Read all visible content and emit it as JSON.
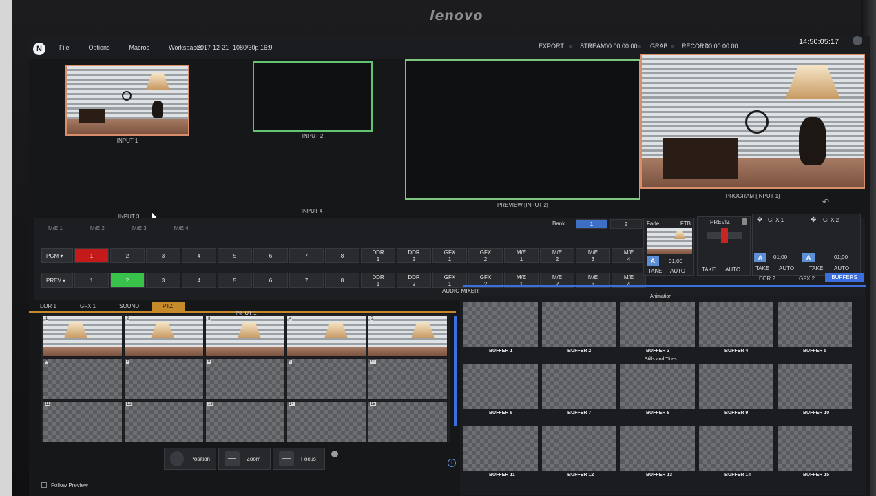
{
  "monitor": {
    "brand": "lenovo"
  },
  "topbar": {
    "menu": [
      "File",
      "Options",
      "Macros",
      "Workspaces"
    ],
    "date": "2017-12-21",
    "format": "1080/30p 16:9",
    "export": "EXPORT",
    "stream": "STREAM",
    "stream_time": "00:00:00:00",
    "grab": "GRAB",
    "record": "RECORD",
    "record_time": "00:00:00:00",
    "clock": "14:50:05:17"
  },
  "monitors": {
    "input1": "INPUT 1",
    "input2": "INPUT 2",
    "input3": "INPUT 3",
    "input4": "INPUT 4",
    "preview": "PREVIEW [INPUT 2]",
    "program": "PROGRAM [INPUT 1]"
  },
  "me_tabs": [
    "M/E 1",
    "M/E 2",
    "M/E 3",
    "M/E 4"
  ],
  "bank": {
    "label": "Bank",
    "options": [
      "1",
      "2"
    ]
  },
  "pgm_row": {
    "label": "PGM ▾",
    "buttons": [
      "1",
      "2",
      "3",
      "4",
      "5",
      "6",
      "7",
      "8",
      "DDR\n1",
      "DDR\n2",
      "GFX\n1",
      "GFX\n2",
      "M/E\n1",
      "M/E\n2",
      "M/E\n3",
      "M/E\n4"
    ]
  },
  "prev_row": {
    "label": "PREV ▾",
    "buttons": [
      "1",
      "2",
      "3",
      "4",
      "5",
      "6",
      "7",
      "8",
      "DDR\n1",
      "DDR\n2",
      "GFX\n1",
      "GFX\n2",
      "M/E\n1",
      "M/E\n2",
      "M/E\n3",
      "M/E\n4"
    ]
  },
  "transition": {
    "fade": "Fade",
    "ftb": "FTB",
    "a": "A",
    "time": "01;00",
    "take": "TAKE",
    "auto": "AUTO"
  },
  "previz": {
    "label": "PREVIZ",
    "take": "TAKE",
    "auto": "AUTO"
  },
  "gfx1": {
    "label": "GFX 1",
    "a": "A",
    "time": "01;00",
    "auto": "AUTO",
    "take": "TAKE"
  },
  "gfx2": {
    "label": "GFX 2",
    "a": "A",
    "time": "01;00",
    "auto": "AUTO",
    "take": "TAKE"
  },
  "right_tabs": [
    "DDR 2",
    "GFX 2",
    "BUFFERS"
  ],
  "audio_mixer": "AUDIO MIXER",
  "section_tabs": [
    "DDR 1",
    "GFX 1",
    "SOUND",
    "PTZ"
  ],
  "ptz": {
    "input_label": "INPUT 1",
    "presets": [
      "1",
      "2",
      "3",
      "4",
      "5",
      "6",
      "7",
      "8",
      "9",
      "10",
      "11",
      "12",
      "13",
      "14",
      "15"
    ],
    "controls": [
      "Position",
      "Zoom",
      "Focus"
    ],
    "follow_preview": "Follow Preview"
  },
  "buffers": {
    "animation": "Animation",
    "stills": "Stills and Titles",
    "row1": [
      "BUFFER 1",
      "BUFFER 2",
      "BUFFER 3",
      "BUFFER 4",
      "BUFFER 5"
    ],
    "row2": [
      "BUFFER 6",
      "BUFFER 7",
      "BUFFER 8",
      "BUFFER 9",
      "BUFFER 10"
    ],
    "row3": [
      "BUFFER 11",
      "BUFFER 12",
      "BUFFER 13",
      "BUFFER 14",
      "BUFFER 15"
    ]
  }
}
